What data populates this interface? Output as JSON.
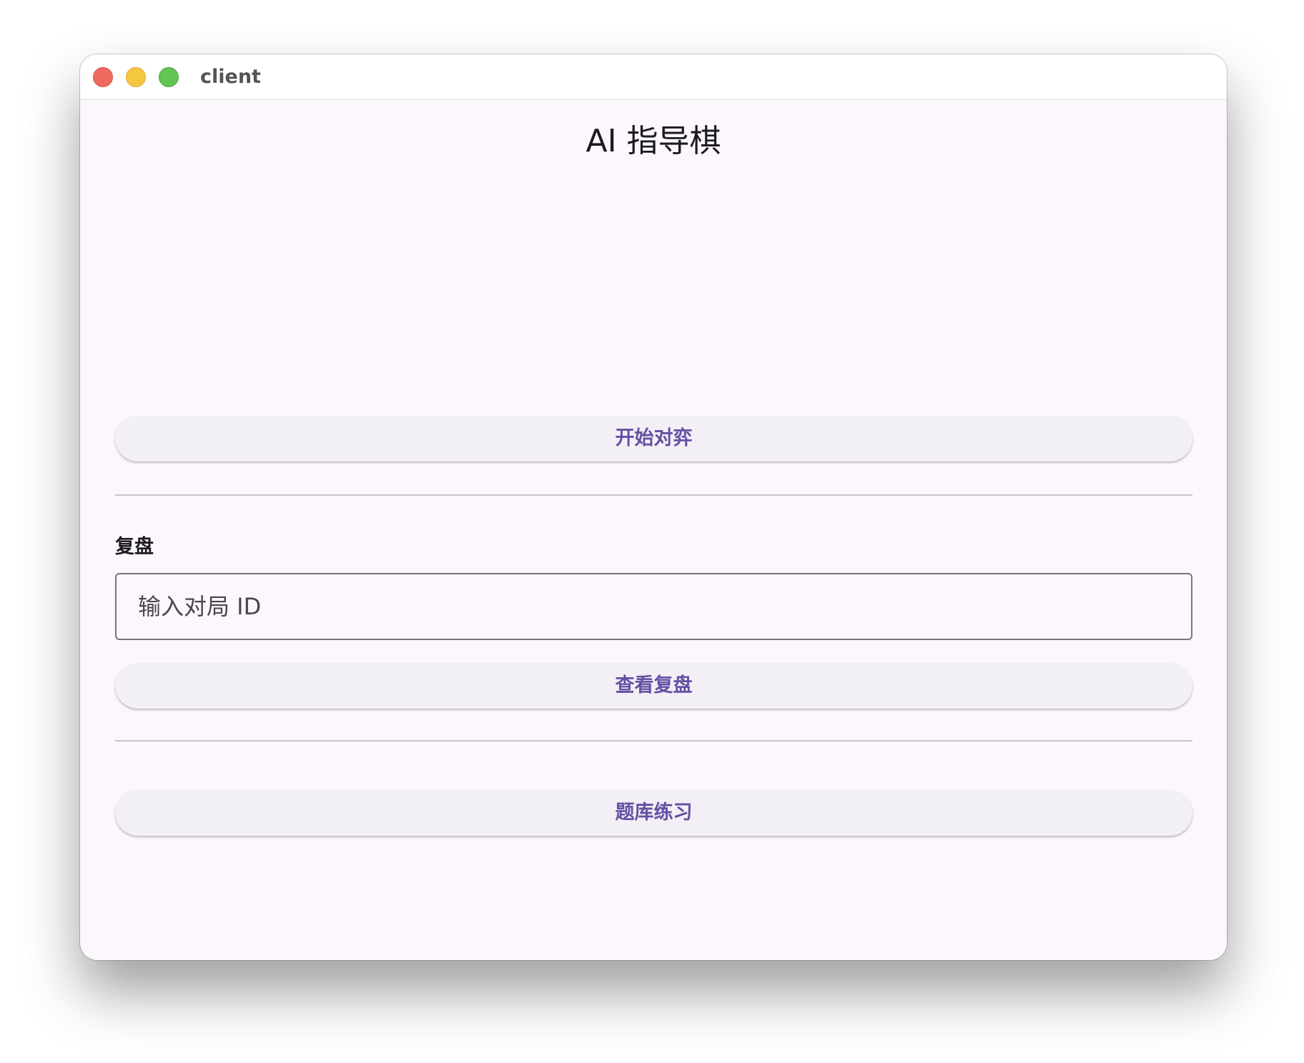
{
  "window": {
    "title": "client"
  },
  "app": {
    "title": "AI 指导棋"
  },
  "play": {
    "start_button": "开始对弈"
  },
  "review": {
    "section_label": "复盘",
    "game_id_input": {
      "value": "",
      "placeholder": "输入对局 ID"
    },
    "view_button": "查看复盘"
  },
  "practice": {
    "button": "题库练习"
  },
  "colors": {
    "accent": "#6550a3",
    "background": "#fbf7fc",
    "button_bg": "#f3eff6"
  }
}
